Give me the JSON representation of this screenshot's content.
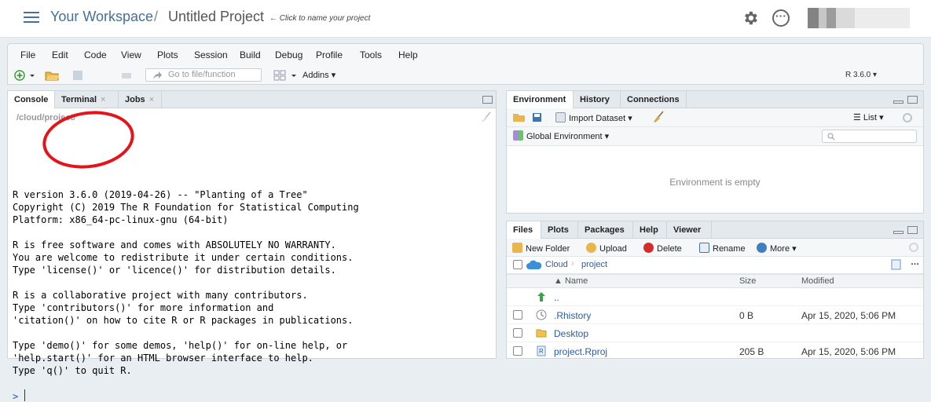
{
  "topbar": {
    "workspace": "Your Workspace",
    "separator": "/",
    "project_title": "Untitled Project",
    "project_hint": "← Click to name your project"
  },
  "menu": [
    "File",
    "Edit",
    "Code",
    "View",
    "Plots",
    "Session",
    "Build",
    "Debug",
    "Profile",
    "Tools",
    "Help"
  ],
  "toolbar": {
    "goto_placeholder": "Go to file/function",
    "addins_label": "Addins",
    "r_version": "R 3.6.0"
  },
  "console_pane": {
    "tabs": [
      {
        "label": "Console",
        "active": true
      },
      {
        "label": "Terminal",
        "closable": true
      },
      {
        "label": "Jobs",
        "closable": true
      }
    ],
    "path": "/cloud/project/",
    "lines": [
      "R version 3.6.0 (2019-04-26) -- \"Planting of a Tree\"",
      "Copyright (C) 2019 The R Foundation for Statistical Computing",
      "Platform: x86_64-pc-linux-gnu (64-bit)",
      "",
      "R is free software and comes with ABSOLUTELY NO WARRANTY.",
      "You are welcome to redistribute it under certain conditions.",
      "Type 'license()' or 'licence()' for distribution details.",
      "",
      "R is a collaborative project with many contributors.",
      "Type 'contributors()' for more information and",
      "'citation()' on how to cite R or R packages in publications.",
      "",
      "Type 'demo()' for some demos, 'help()' for on-line help, or",
      "'help.start()' for an HTML browser interface to help.",
      "Type 'q()' to quit R."
    ],
    "prompt": ">"
  },
  "env_pane": {
    "tabs": [
      "Environment",
      "History",
      "Connections"
    ],
    "import_label": "Import Dataset",
    "list_label": "List",
    "global_env_label": "Global Environment",
    "empty_message": "Environment is empty"
  },
  "files_pane": {
    "tabs": [
      "Files",
      "Plots",
      "Packages",
      "Help",
      "Viewer"
    ],
    "actions": {
      "new_folder": "New Folder",
      "upload": "Upload",
      "delete": "Delete",
      "rename": "Rename",
      "more": "More"
    },
    "breadcrumb": [
      "Cloud",
      "project"
    ],
    "columns": {
      "name": "Name",
      "size": "Size",
      "modified": "Modified"
    },
    "rows": [
      {
        "name": "..",
        "size": "",
        "modified": "",
        "icon": "up-arrow-icon"
      },
      {
        "name": ".Rhistory",
        "size": "0 B",
        "modified": "Apr 15, 2020, 5:06 PM",
        "icon": "history-file-icon"
      },
      {
        "name": "Desktop",
        "size": "",
        "modified": "",
        "icon": "folder-icon"
      },
      {
        "name": "project.Rproj",
        "size": "205 B",
        "modified": "Apr 15, 2020, 5:06 PM",
        "icon": "rproj-icon"
      }
    ]
  },
  "colors": {
    "accent": "#447099",
    "annotation": "#e4141a",
    "link": "#2a5caa"
  }
}
